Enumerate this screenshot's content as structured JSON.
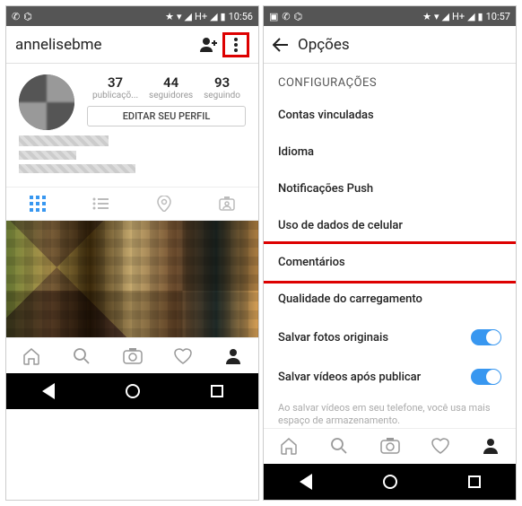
{
  "left": {
    "statusbar": {
      "time": "10:56"
    },
    "appbar": {
      "username": "annelisebme"
    },
    "stats": {
      "posts_n": "37",
      "posts_l": "publicaçõ...",
      "followers_n": "44",
      "followers_l": "seguidores",
      "following_n": "93",
      "following_l": "seguindo"
    },
    "edit_profile": "EDITAR SEU PERFIL"
  },
  "right": {
    "statusbar": {
      "time": "10:57"
    },
    "appbar": {
      "title": "Opções"
    },
    "section": "CONFIGURAÇÕES",
    "items": {
      "linked": "Contas vinculadas",
      "language": "Idioma",
      "push": "Notificações Push",
      "cellular": "Uso de dados de celular",
      "comments": "Comentários",
      "quality": "Qualidade do carregamento",
      "save_photos": "Salvar fotos originais",
      "save_videos": "Salvar vídeos após publicar"
    },
    "hint": "Ao salvar vídeos em seu telefone, você usa mais espaço de armazenamento."
  }
}
